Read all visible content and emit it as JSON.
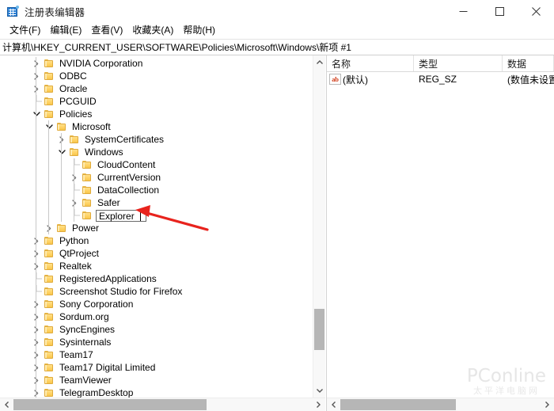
{
  "window": {
    "title": "注册表编辑器",
    "icon": "registry-editor-icon",
    "minimize_label": "最小化",
    "maximize_label": "最大化",
    "close_label": "关闭"
  },
  "menubar": {
    "items": [
      {
        "label": "文件(F)",
        "name": "menu-file"
      },
      {
        "label": "编辑(E)",
        "name": "menu-edit"
      },
      {
        "label": "查看(V)",
        "name": "menu-view"
      },
      {
        "label": "收藏夹(A)",
        "name": "menu-favorites"
      },
      {
        "label": "帮助(H)",
        "name": "menu-help"
      }
    ]
  },
  "address": {
    "path": "计算机\\HKEY_CURRENT_USER\\SOFTWARE\\Policies\\Microsoft\\Windows\\新项 #1"
  },
  "tree": {
    "nodes": [
      {
        "label": "NVIDIA Corporation",
        "depth": 1,
        "twisty": "collapsed",
        "editing": false
      },
      {
        "label": "ODBC",
        "depth": 1,
        "twisty": "collapsed",
        "editing": false
      },
      {
        "label": "Oracle",
        "depth": 1,
        "twisty": "collapsed",
        "editing": false
      },
      {
        "label": "PCGUID",
        "depth": 1,
        "twisty": "none",
        "editing": false
      },
      {
        "label": "Policies",
        "depth": 1,
        "twisty": "expanded",
        "editing": false
      },
      {
        "label": "Microsoft",
        "depth": 2,
        "twisty": "expanded",
        "editing": false
      },
      {
        "label": "SystemCertificates",
        "depth": 3,
        "twisty": "collapsed",
        "editing": false
      },
      {
        "label": "Windows",
        "depth": 3,
        "twisty": "expanded",
        "editing": false
      },
      {
        "label": "CloudContent",
        "depth": 4,
        "twisty": "none",
        "editing": false
      },
      {
        "label": "CurrentVersion",
        "depth": 4,
        "twisty": "collapsed",
        "editing": false
      },
      {
        "label": "DataCollection",
        "depth": 4,
        "twisty": "none",
        "editing": false
      },
      {
        "label": "Safer",
        "depth": 4,
        "twisty": "collapsed",
        "editing": false
      },
      {
        "label": "Explorer",
        "depth": 4,
        "twisty": "none",
        "editing": true
      },
      {
        "label": "Power",
        "depth": 2,
        "twisty": "collapsed",
        "editing": false
      },
      {
        "label": "Python",
        "depth": 1,
        "twisty": "collapsed",
        "editing": false
      },
      {
        "label": "QtProject",
        "depth": 1,
        "twisty": "collapsed",
        "editing": false
      },
      {
        "label": "Realtek",
        "depth": 1,
        "twisty": "collapsed",
        "editing": false
      },
      {
        "label": "RegisteredApplications",
        "depth": 1,
        "twisty": "none",
        "editing": false
      },
      {
        "label": "Screenshot Studio for Firefox",
        "depth": 1,
        "twisty": "none",
        "editing": false
      },
      {
        "label": "Sony Corporation",
        "depth": 1,
        "twisty": "collapsed",
        "editing": false
      },
      {
        "label": "Sordum.org",
        "depth": 1,
        "twisty": "collapsed",
        "editing": false
      },
      {
        "label": "SyncEngines",
        "depth": 1,
        "twisty": "collapsed",
        "editing": false
      },
      {
        "label": "Sysinternals",
        "depth": 1,
        "twisty": "collapsed",
        "editing": false
      },
      {
        "label": "Team17",
        "depth": 1,
        "twisty": "collapsed",
        "editing": false
      },
      {
        "label": "Team17 Digital Limited",
        "depth": 1,
        "twisty": "collapsed",
        "editing": false
      },
      {
        "label": "TeamViewer",
        "depth": 1,
        "twisty": "collapsed",
        "editing": false
      },
      {
        "label": "TelegramDesktop",
        "depth": 1,
        "twisty": "collapsed",
        "editing": false
      }
    ]
  },
  "values_list": {
    "columns": [
      {
        "label": "名称",
        "name": "column-header-name"
      },
      {
        "label": "类型",
        "name": "column-header-type"
      },
      {
        "label": "数据",
        "name": "column-header-data"
      }
    ],
    "rows": [
      {
        "icon": "ab-string-icon",
        "name": "(默认)",
        "type": "REG_SZ",
        "data": "(数值未设置)"
      }
    ]
  },
  "annotation": {
    "arrow_color": "#e8231d"
  },
  "watermark": {
    "main": "PConline",
    "sub": "太平洋电脑网"
  }
}
